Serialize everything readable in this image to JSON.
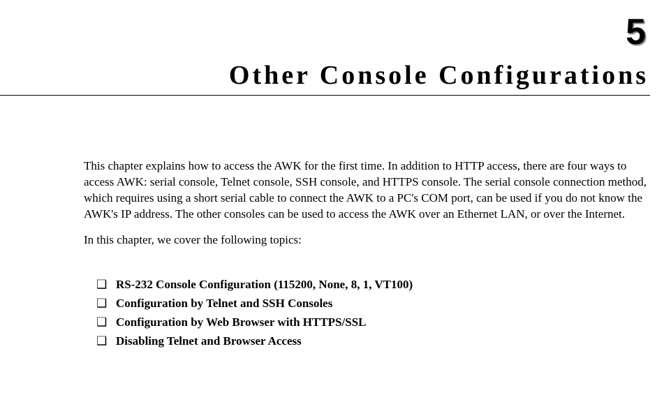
{
  "chapter": {
    "number": "5",
    "title": "Other Console Configurations"
  },
  "intro": "This chapter explains how to access the AWK for the first time. In addition to HTTP access, there are four ways to access AWK: serial console, Telnet console, SSH console, and HTTPS console. The serial console connection method, which requires using a short serial cable to connect the AWK to a PC's COM port, can be used if you do not know the AWK's IP address. The other consoles can be used to access the AWK over an Ethernet LAN, or over the Internet.",
  "topics_intro": "In this chapter, we cover the following topics:",
  "topics": [
    "RS-232 Console Configuration (115200, None, 8, 1, VT100)",
    "Configuration by Telnet and SSH Consoles",
    "Configuration by Web Browser with HTTPS/SSL",
    "Disabling Telnet and Browser Access"
  ]
}
